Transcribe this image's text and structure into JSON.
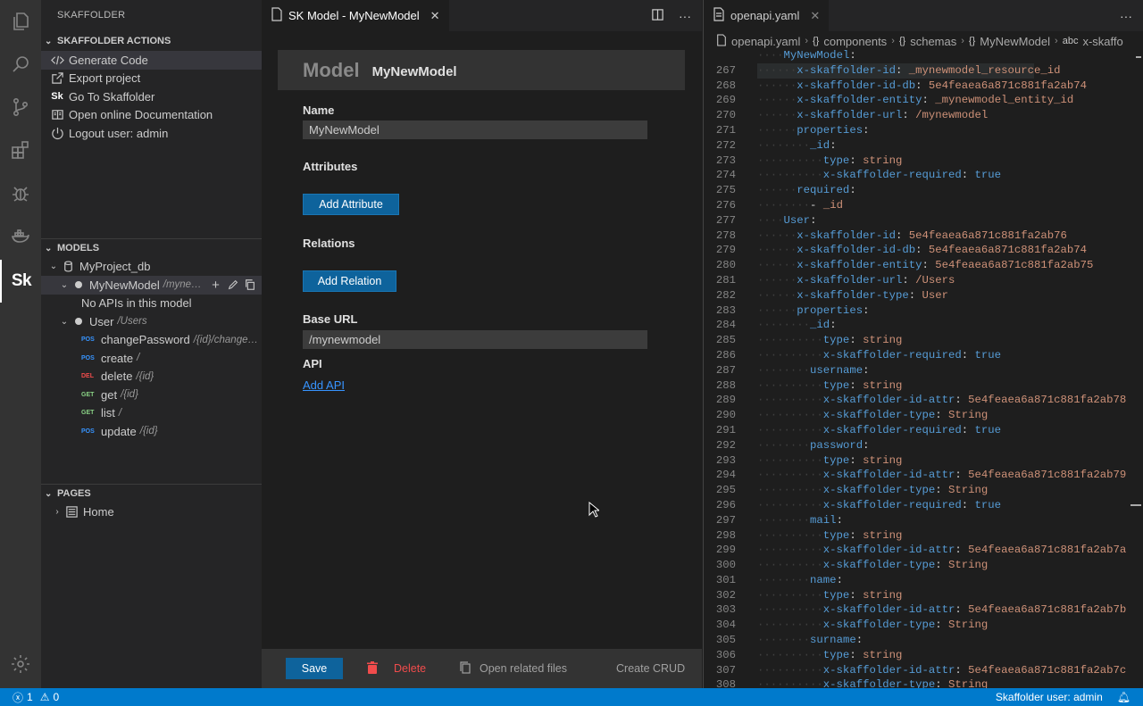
{
  "activity_bar": {
    "items": [
      "explorer-icon",
      "search-icon",
      "source-control-icon",
      "extensions-icon",
      "debug-icon",
      "docker-icon",
      "skaffolder-icon",
      "gear-icon"
    ],
    "skaffolder_logo": "Sk"
  },
  "sidebar": {
    "title": "SKAFFOLDER",
    "actions": {
      "header": "SKAFFOLDER ACTIONS",
      "items": [
        {
          "label": "Generate Code",
          "icon": "code-icon"
        },
        {
          "label": "Export project",
          "icon": "export-icon"
        },
        {
          "label": "Go To Skaffolder",
          "icon": "sk-icon"
        },
        {
          "label": "Open online Documentation",
          "icon": "book-icon"
        },
        {
          "label": "Logout user: admin",
          "icon": "power-icon"
        }
      ]
    },
    "models": {
      "header": "MODELS",
      "db": "MyProject_db",
      "model1": {
        "name": "MyNewModel",
        "url": "/myne…",
        "empty": "No APIs in this model"
      },
      "model2": {
        "name": "User",
        "url": "/Users"
      },
      "apis": [
        {
          "method": "POS",
          "name": "changePassword",
          "url": "/{id}/change…"
        },
        {
          "method": "POS",
          "name": "create",
          "url": "/"
        },
        {
          "method": "DEL",
          "name": "delete",
          "url": "/{id}"
        },
        {
          "method": "GET",
          "name": "get",
          "url": "/{id}"
        },
        {
          "method": "GET",
          "name": "list",
          "url": "/"
        },
        {
          "method": "POS",
          "name": "update",
          "url": "/{id}"
        }
      ]
    },
    "pages": {
      "header": "PAGES",
      "items": [
        {
          "label": "Home"
        }
      ]
    }
  },
  "editor_left": {
    "tab_title": "SK Model - MyNewModel",
    "header_title": "Model",
    "header_name": "MyNewModel",
    "name_label": "Name",
    "name_value": "MyNewModel",
    "attributes_label": "Attributes",
    "add_attribute": "Add Attribute",
    "relations_label": "Relations",
    "add_relation": "Add Relation",
    "base_url_label": "Base URL",
    "base_url_value": "/mynewmodel",
    "api_label": "API",
    "add_api": "Add API",
    "footer": {
      "save": "Save",
      "delete": "Delete",
      "open_related": "Open related files",
      "create_crud": "Create CRUD"
    }
  },
  "editor_right": {
    "tab_title": "openapi.yaml",
    "breadcrumb": [
      "openapi.yaml",
      "components",
      "schemas",
      "MyNewModel",
      "x-skaffo"
    ],
    "lines": [
      {
        "n": "",
        "indent": 2,
        "key": "MyNewModel",
        "val": "",
        "vtype": ""
      },
      {
        "n": "267",
        "indent": 3,
        "key": "x-skaffolder-id",
        "val": "_mynewmodel_resource_id",
        "vtype": "s",
        "hl": true
      },
      {
        "n": "268",
        "indent": 3,
        "key": "x-skaffolder-id-db",
        "val": "5e4feaea6a871c881fa2ab74",
        "vtype": "s"
      },
      {
        "n": "269",
        "indent": 3,
        "key": "x-skaffolder-entity",
        "val": "_mynewmodel_entity_id",
        "vtype": "s"
      },
      {
        "n": "270",
        "indent": 3,
        "key": "x-skaffolder-url",
        "val": "/mynewmodel",
        "vtype": "s"
      },
      {
        "n": "271",
        "indent": 3,
        "key": "properties",
        "val": "",
        "vtype": ""
      },
      {
        "n": "272",
        "indent": 4,
        "key": "_id",
        "val": "",
        "vtype": ""
      },
      {
        "n": "273",
        "indent": 5,
        "key": "type",
        "val": "string",
        "vtype": "s"
      },
      {
        "n": "274",
        "indent": 5,
        "key": "x-skaffolder-required",
        "val": "true",
        "vtype": "b"
      },
      {
        "n": "275",
        "indent": 3,
        "key": "required",
        "val": "",
        "vtype": ""
      },
      {
        "n": "276",
        "indent": 4,
        "key": "",
        "val": "_id",
        "vtype": "list"
      },
      {
        "n": "277",
        "indent": 2,
        "key": "User",
        "val": "",
        "vtype": ""
      },
      {
        "n": "278",
        "indent": 3,
        "key": "x-skaffolder-id",
        "val": "5e4feaea6a871c881fa2ab76",
        "vtype": "s"
      },
      {
        "n": "279",
        "indent": 3,
        "key": "x-skaffolder-id-db",
        "val": "5e4feaea6a871c881fa2ab74",
        "vtype": "s"
      },
      {
        "n": "280",
        "indent": 3,
        "key": "x-skaffolder-entity",
        "val": "5e4feaea6a871c881fa2ab75",
        "vtype": "s"
      },
      {
        "n": "281",
        "indent": 3,
        "key": "x-skaffolder-url",
        "val": "/Users",
        "vtype": "s"
      },
      {
        "n": "282",
        "indent": 3,
        "key": "x-skaffolder-type",
        "val": "User",
        "vtype": "s"
      },
      {
        "n": "283",
        "indent": 3,
        "key": "properties",
        "val": "",
        "vtype": ""
      },
      {
        "n": "284",
        "indent": 4,
        "key": "_id",
        "val": "",
        "vtype": ""
      },
      {
        "n": "285",
        "indent": 5,
        "key": "type",
        "val": "string",
        "vtype": "s"
      },
      {
        "n": "286",
        "indent": 5,
        "key": "x-skaffolder-required",
        "val": "true",
        "vtype": "b"
      },
      {
        "n": "287",
        "indent": 4,
        "key": "username",
        "val": "",
        "vtype": ""
      },
      {
        "n": "288",
        "indent": 5,
        "key": "type",
        "val": "string",
        "vtype": "s"
      },
      {
        "n": "289",
        "indent": 5,
        "key": "x-skaffolder-id-attr",
        "val": "5e4feaea6a871c881fa2ab78",
        "vtype": "s"
      },
      {
        "n": "290",
        "indent": 5,
        "key": "x-skaffolder-type",
        "val": "String",
        "vtype": "s"
      },
      {
        "n": "291",
        "indent": 5,
        "key": "x-skaffolder-required",
        "val": "true",
        "vtype": "b"
      },
      {
        "n": "292",
        "indent": 4,
        "key": "password",
        "val": "",
        "vtype": ""
      },
      {
        "n": "293",
        "indent": 5,
        "key": "type",
        "val": "string",
        "vtype": "s"
      },
      {
        "n": "294",
        "indent": 5,
        "key": "x-skaffolder-id-attr",
        "val": "5e4feaea6a871c881fa2ab79",
        "vtype": "s"
      },
      {
        "n": "295",
        "indent": 5,
        "key": "x-skaffolder-type",
        "val": "String",
        "vtype": "s"
      },
      {
        "n": "296",
        "indent": 5,
        "key": "x-skaffolder-required",
        "val": "true",
        "vtype": "b"
      },
      {
        "n": "297",
        "indent": 4,
        "key": "mail",
        "val": "",
        "vtype": ""
      },
      {
        "n": "298",
        "indent": 5,
        "key": "type",
        "val": "string",
        "vtype": "s"
      },
      {
        "n": "299",
        "indent": 5,
        "key": "x-skaffolder-id-attr",
        "val": "5e4feaea6a871c881fa2ab7a",
        "vtype": "s"
      },
      {
        "n": "300",
        "indent": 5,
        "key": "x-skaffolder-type",
        "val": "String",
        "vtype": "s"
      },
      {
        "n": "301",
        "indent": 4,
        "key": "name",
        "val": "",
        "vtype": ""
      },
      {
        "n": "302",
        "indent": 5,
        "key": "type",
        "val": "string",
        "vtype": "s"
      },
      {
        "n": "303",
        "indent": 5,
        "key": "x-skaffolder-id-attr",
        "val": "5e4feaea6a871c881fa2ab7b",
        "vtype": "s"
      },
      {
        "n": "304",
        "indent": 5,
        "key": "x-skaffolder-type",
        "val": "String",
        "vtype": "s"
      },
      {
        "n": "305",
        "indent": 4,
        "key": "surname",
        "val": "",
        "vtype": ""
      },
      {
        "n": "306",
        "indent": 5,
        "key": "type",
        "val": "string",
        "vtype": "s"
      },
      {
        "n": "307",
        "indent": 5,
        "key": "x-skaffolder-id-attr",
        "val": "5e4feaea6a871c881fa2ab7c",
        "vtype": "s"
      },
      {
        "n": "308",
        "indent": 5,
        "key": "x-skaffolder-type",
        "val": "String",
        "vtype": "s"
      }
    ]
  },
  "status_bar": {
    "errors": "1",
    "warnings": "0",
    "user": "Skaffolder user: admin"
  },
  "colors": {
    "accent": "#007acc",
    "button": "#0e639c",
    "delete": "#f14c4c"
  }
}
